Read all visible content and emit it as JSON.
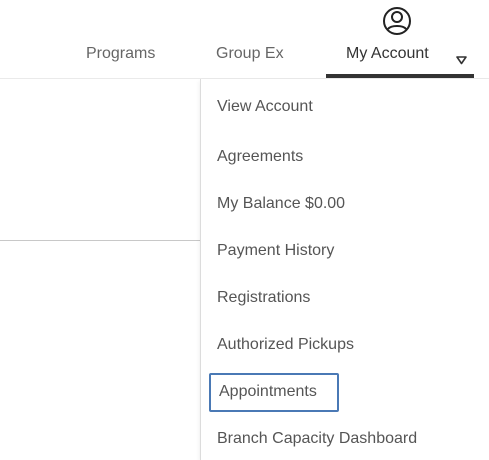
{
  "nav": {
    "programs_label": "Programs",
    "group_ex_label": "Group Ex",
    "account_label": "My Account",
    "account_icon": "user-circle-icon",
    "caret_icon": "caret-down-icon",
    "accent_color": "#333333"
  },
  "account_menu": {
    "focus_color": "#4a79b5",
    "items": [
      {
        "label": "View Account"
      },
      {
        "label": "Agreements"
      },
      {
        "label": "My Balance $0.00"
      },
      {
        "label": "Payment History"
      },
      {
        "label": "Registrations"
      },
      {
        "label": "Authorized Pickups"
      },
      {
        "label": "Appointments"
      },
      {
        "label": "Branch Capacity Dashboard"
      }
    ]
  }
}
